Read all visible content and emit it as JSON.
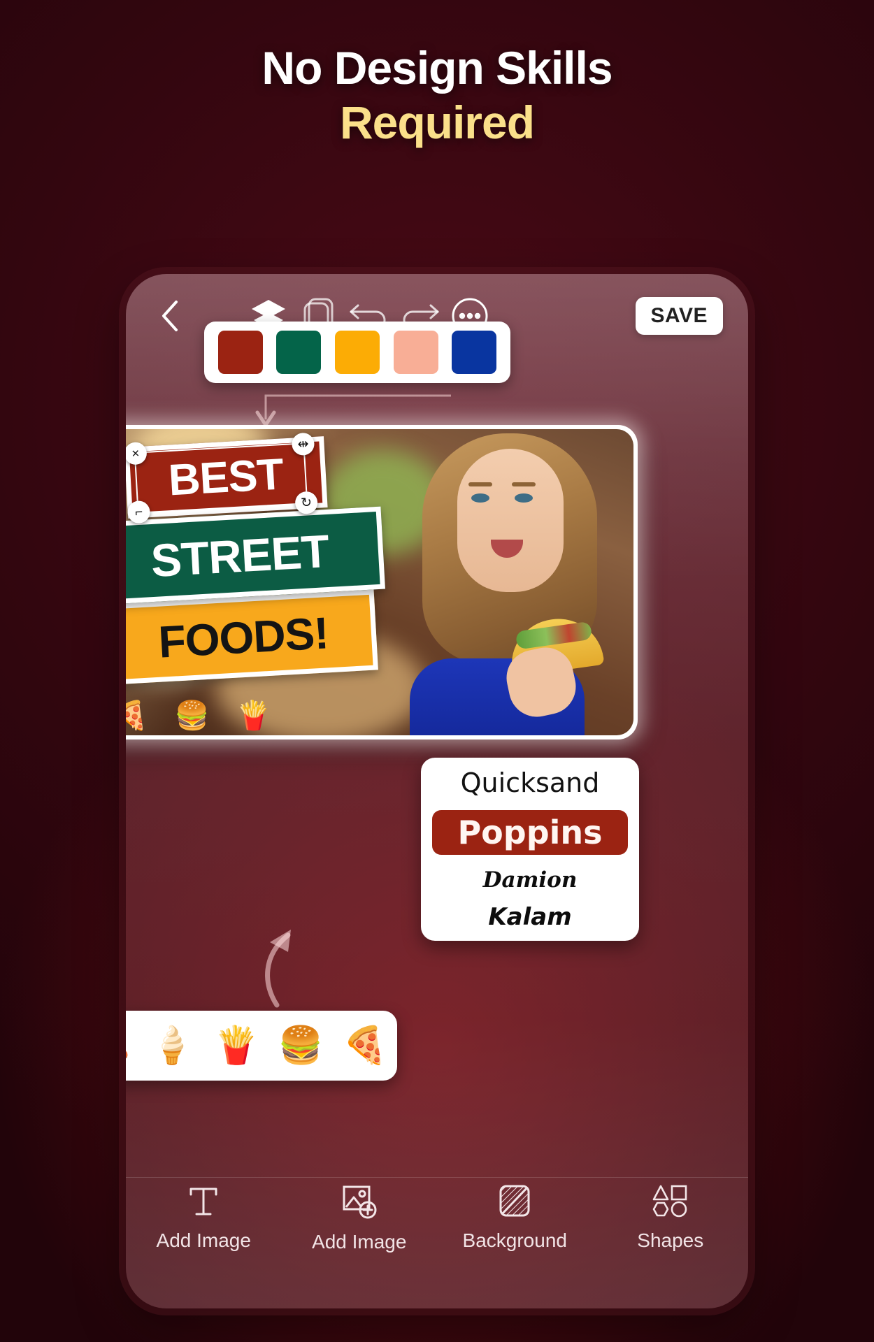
{
  "headline": {
    "line1": "No Design Skills",
    "line2": "Required",
    "line1_color": "#FFFFFF",
    "line2_color": "#FBE08A"
  },
  "toolbar": {
    "back_icon": "chevron-left-icon",
    "layers_icon": "layers-icon",
    "canvas_icon": "canvas-size-icon",
    "undo_icon": "undo-icon",
    "redo_icon": "redo-icon",
    "more_icon": "more-ellipsis-icon",
    "save_label": "SAVE"
  },
  "palette": {
    "swatches": [
      {
        "name": "brick-red",
        "hex": "#9B2312"
      },
      {
        "name": "forest-green",
        "hex": "#046449"
      },
      {
        "name": "amber",
        "hex": "#FCAC05"
      },
      {
        "name": "peach",
        "hex": "#F8AE96"
      },
      {
        "name": "navy-blue",
        "hex": "#0935A0"
      }
    ]
  },
  "canvas": {
    "banners": [
      {
        "text": "BEST",
        "bg": "#9B2312",
        "fg": "#FFFFFF"
      },
      {
        "text": "STREET",
        "bg": "#0C5C44",
        "fg": "#FFFFFF"
      },
      {
        "text": "FOODS!",
        "bg": "#F8A81C",
        "fg": "#141414"
      }
    ],
    "selection": {
      "delete_handle": "×",
      "resize_handle": "⇹",
      "rotate_handle": "↻",
      "scale_handle": "⌐"
    },
    "mini_stickers": [
      "🍕",
      "🍔",
      "🍟"
    ]
  },
  "sticker_tray": {
    "items": [
      {
        "name": "hotdog-flame-sticker",
        "glyph": "🌭"
      },
      {
        "name": "ice-cream-sticker",
        "glyph": "🍦"
      },
      {
        "name": "fries-sticker",
        "glyph": "🍟"
      },
      {
        "name": "burger-sticker",
        "glyph": "🍔"
      },
      {
        "name": "pizza-sticker",
        "glyph": "🍕"
      }
    ]
  },
  "font_panel": {
    "fonts": [
      {
        "label": "Quicksand",
        "selected": false
      },
      {
        "label": "Poppins",
        "selected": true
      },
      {
        "label": "Damion",
        "selected": false
      },
      {
        "label": "Kalam",
        "selected": false
      }
    ],
    "selected_bg": "#9B2312"
  },
  "bottom_nav": {
    "items": [
      {
        "label": "Add Image",
        "icon": "text-tool-icon"
      },
      {
        "label": "Add Image",
        "icon": "add-image-icon"
      },
      {
        "label": "Background",
        "icon": "background-icon"
      },
      {
        "label": "Shapes",
        "icon": "shapes-icon"
      }
    ]
  }
}
